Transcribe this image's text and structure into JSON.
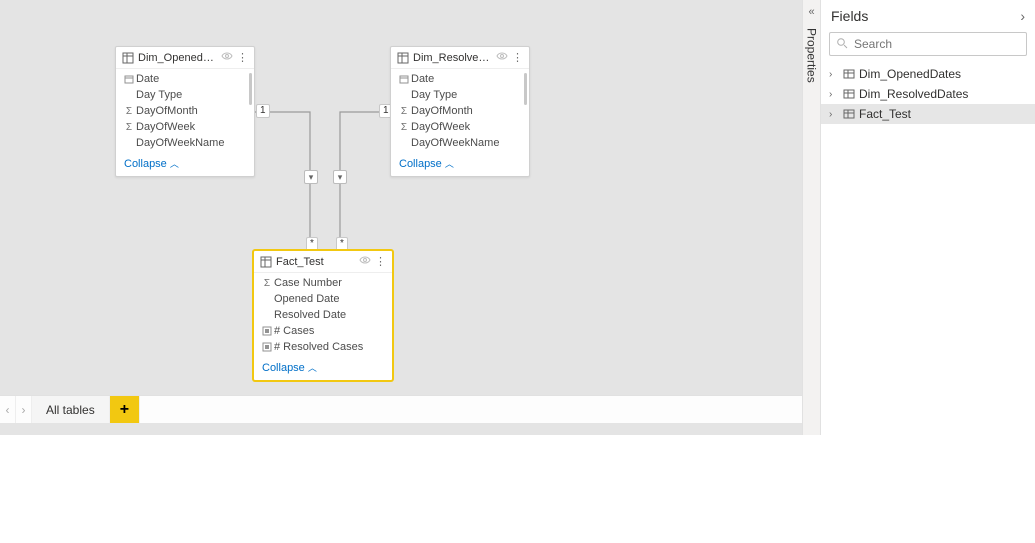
{
  "canvas": {
    "tables": {
      "dim_opened": {
        "title": "Dim_OpenedDates",
        "fields": [
          "Date",
          "Day Type",
          "DayOfMonth",
          "DayOfWeek",
          "DayOfWeekName"
        ],
        "icons": [
          "date",
          "none",
          "sigma",
          "sigma",
          "none"
        ]
      },
      "dim_resolved": {
        "title": "Dim_ResolvedDates",
        "fields": [
          "Date",
          "Day Type",
          "DayOfMonth",
          "DayOfWeek",
          "DayOfWeekName"
        ],
        "icons": [
          "date",
          "none",
          "sigma",
          "sigma",
          "none"
        ]
      },
      "fact": {
        "title": "Fact_Test",
        "fields": [
          "Case Number",
          "Opened Date",
          "Resolved Date",
          "# Cases",
          "# Resolved Cases"
        ],
        "icons": [
          "sigma",
          "none",
          "none",
          "measure",
          "measure"
        ]
      }
    },
    "collapse_label": "Collapse",
    "relationship": {
      "one": "1",
      "many": "*"
    }
  },
  "bottom_tabs": {
    "prev": "‹",
    "next": "›",
    "all_tables": "All tables",
    "add": "+"
  },
  "properties_rail": {
    "collapse_glyph": "«",
    "label": "Properties"
  },
  "fields_panel": {
    "title": "Fields",
    "caret": "›",
    "search_placeholder": "Search",
    "tree": [
      {
        "label": "Dim_OpenedDates",
        "selected": false
      },
      {
        "label": "Dim_ResolvedDates",
        "selected": false
      },
      {
        "label": "Fact_Test",
        "selected": true
      }
    ]
  }
}
